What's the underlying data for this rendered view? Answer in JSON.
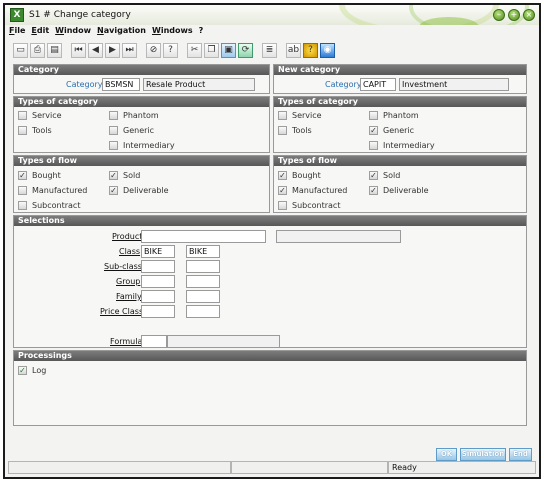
{
  "window": {
    "title": "S1 # Change category"
  },
  "menu": [
    "File",
    "Edit",
    "Window",
    "Navigation",
    "Windows",
    "?"
  ],
  "toolbar": [
    "new-doc-icon",
    "print-icon",
    "print-preview-icon",
    "first-record-icon",
    "previous-record-icon",
    "next-record-icon",
    "last-record-icon",
    "attach-icon",
    "help-icon",
    "cut-icon",
    "copy-icon",
    "paste-icon",
    "refresh-icon",
    "list-icon",
    "text-field-icon",
    "help-question-icon",
    "globe-icon"
  ],
  "category": {
    "header": "Category",
    "label": "Category",
    "code": "BSMSN",
    "description": "Resale Product"
  },
  "new_category": {
    "header": "New category",
    "label": "Category",
    "code": "CAPIT",
    "description": "Investment"
  },
  "types_left": {
    "header": "Types of category",
    "service": "Service",
    "phantom": "Phantom",
    "tools": "Tools",
    "generic": "Generic",
    "intermediary": "Intermediary"
  },
  "types_right": {
    "header": "Types of category",
    "service": "Service",
    "phantom": "Phantom",
    "tools": "Tools",
    "generic": "Generic",
    "intermediary": "Intermediary",
    "generic_checked": true
  },
  "flow_left": {
    "header": "Types of flow",
    "bought": "Bought",
    "sold": "Sold",
    "manufactured": "Manufactured",
    "deliverable": "Deliverable",
    "subcontract": "Subcontract",
    "checked": [
      "bought",
      "sold",
      "deliverable"
    ]
  },
  "flow_right": {
    "header": "Types of flow",
    "bought": "Bought",
    "sold": "Sold",
    "manufactured": "Manufactured",
    "deliverable": "Deliverable",
    "subcontract": "Subcontract",
    "checked": [
      "bought",
      "sold",
      "manufactured",
      "deliverable"
    ]
  },
  "selections": {
    "header": "Selections",
    "product": "Product",
    "product_value": "",
    "product_desc": "",
    "class": "Class",
    "class_from": "BIKE",
    "class_to": "BIKE",
    "subclass": "Sub-class",
    "group": "Group",
    "family": "Family",
    "price_class": "Price Class",
    "formula": "Formula"
  },
  "processings": {
    "header": "Processings",
    "log": "Log",
    "log_checked": true
  },
  "buttons": {
    "ok": "OK",
    "simulation": "Simulation",
    "end": "End"
  },
  "status": {
    "ready": "Ready"
  },
  "colors": {
    "panel_header": "#666666",
    "label_blue": "#2a6fb0",
    "button": "#98c6e6"
  }
}
